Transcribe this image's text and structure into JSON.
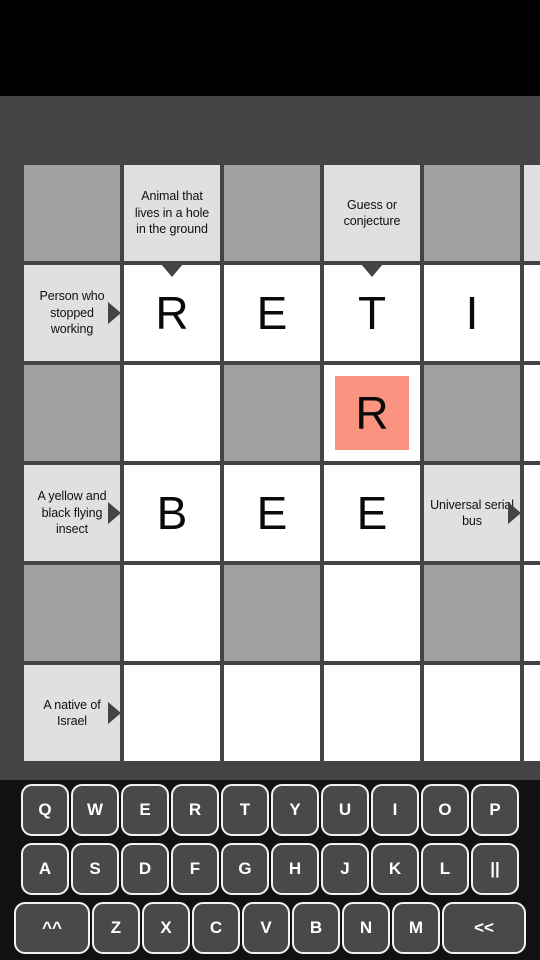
{
  "app": {
    "type": "crossword-puzzle",
    "background_color": "#444444",
    "status_bar_color": "#000000"
  },
  "grid": {
    "columns": 6,
    "rows": 6,
    "cell_size_px": 100,
    "colors": {
      "block": "#A0A0A0",
      "clue": "#E0E0E0",
      "letter": "#FFFFFF",
      "highlight": "#FA9480",
      "border": "#444444",
      "text": "#101010"
    },
    "cells": [
      {
        "r": 0,
        "c": 0,
        "kind": "block",
        "text": ""
      },
      {
        "r": 0,
        "c": 1,
        "kind": "clue",
        "text": "Animal that lives in a hole in the ground"
      },
      {
        "r": 0,
        "c": 2,
        "kind": "block",
        "text": ""
      },
      {
        "r": 0,
        "c": 3,
        "kind": "clue",
        "text": "Guess or conjecture"
      },
      {
        "r": 0,
        "c": 4,
        "kind": "block",
        "text": ""
      },
      {
        "r": 0,
        "c": 5,
        "kind": "clue",
        "text": ""
      },
      {
        "r": 1,
        "c": 0,
        "kind": "clue",
        "text": "Person who stopped working",
        "arrow": "right"
      },
      {
        "r": 1,
        "c": 1,
        "kind": "letter",
        "text": "R",
        "arrow": "down"
      },
      {
        "r": 1,
        "c": 2,
        "kind": "letter",
        "text": "E"
      },
      {
        "r": 1,
        "c": 3,
        "kind": "letter",
        "text": "T",
        "arrow": "down"
      },
      {
        "r": 1,
        "c": 4,
        "kind": "letter",
        "text": "I"
      },
      {
        "r": 1,
        "c": 5,
        "kind": "letter",
        "text": ""
      },
      {
        "r": 2,
        "c": 0,
        "kind": "block",
        "text": ""
      },
      {
        "r": 2,
        "c": 1,
        "kind": "letter",
        "text": ""
      },
      {
        "r": 2,
        "c": 2,
        "kind": "block",
        "text": ""
      },
      {
        "r": 2,
        "c": 3,
        "kind": "letter",
        "text": "R",
        "highlight": true
      },
      {
        "r": 2,
        "c": 4,
        "kind": "block",
        "text": ""
      },
      {
        "r": 2,
        "c": 5,
        "kind": "letter",
        "text": ""
      },
      {
        "r": 3,
        "c": 0,
        "kind": "clue",
        "text": "A yellow and black flying insect",
        "arrow": "right"
      },
      {
        "r": 3,
        "c": 1,
        "kind": "letter",
        "text": "B"
      },
      {
        "r": 3,
        "c": 2,
        "kind": "letter",
        "text": "E"
      },
      {
        "r": 3,
        "c": 3,
        "kind": "letter",
        "text": "E"
      },
      {
        "r": 3,
        "c": 4,
        "kind": "clue",
        "text": "Universal serial bus",
        "arrow": "right"
      },
      {
        "r": 3,
        "c": 5,
        "kind": "letter",
        "text": ""
      },
      {
        "r": 4,
        "c": 0,
        "kind": "block",
        "text": ""
      },
      {
        "r": 4,
        "c": 1,
        "kind": "letter",
        "text": ""
      },
      {
        "r": 4,
        "c": 2,
        "kind": "block",
        "text": ""
      },
      {
        "r": 4,
        "c": 3,
        "kind": "letter",
        "text": ""
      },
      {
        "r": 4,
        "c": 4,
        "kind": "block",
        "text": ""
      },
      {
        "r": 4,
        "c": 5,
        "kind": "letter",
        "text": ""
      },
      {
        "r": 5,
        "c": 0,
        "kind": "clue",
        "text": "A native of Israel",
        "arrow": "right"
      },
      {
        "r": 5,
        "c": 1,
        "kind": "letter",
        "text": ""
      },
      {
        "r": 5,
        "c": 2,
        "kind": "letter",
        "text": ""
      },
      {
        "r": 5,
        "c": 3,
        "kind": "letter",
        "text": ""
      },
      {
        "r": 5,
        "c": 4,
        "kind": "letter",
        "text": ""
      },
      {
        "r": 5,
        "c": 5,
        "kind": "letter",
        "text": ""
      }
    ]
  },
  "keyboard": {
    "background_color": "#111111",
    "key_fill": "#494949",
    "key_border": "#F2F2F2",
    "key_text": "#FFFFFF",
    "rows": [
      [
        {
          "label": "Q",
          "name": "key-q"
        },
        {
          "label": "W",
          "name": "key-w"
        },
        {
          "label": "E",
          "name": "key-e"
        },
        {
          "label": "R",
          "name": "key-r"
        },
        {
          "label": "T",
          "name": "key-t"
        },
        {
          "label": "Y",
          "name": "key-y"
        },
        {
          "label": "U",
          "name": "key-u"
        },
        {
          "label": "I",
          "name": "key-i"
        },
        {
          "label": "O",
          "name": "key-o"
        },
        {
          "label": "P",
          "name": "key-p"
        }
      ],
      [
        {
          "label": "A",
          "name": "key-a"
        },
        {
          "label": "S",
          "name": "key-s"
        },
        {
          "label": "D",
          "name": "key-d"
        },
        {
          "label": "F",
          "name": "key-f"
        },
        {
          "label": "G",
          "name": "key-g"
        },
        {
          "label": "H",
          "name": "key-h"
        },
        {
          "label": "J",
          "name": "key-j"
        },
        {
          "label": "K",
          "name": "key-k"
        },
        {
          "label": "L",
          "name": "key-l"
        },
        {
          "label": "||",
          "name": "key-pause"
        }
      ],
      [
        {
          "label": "^^",
          "name": "key-shift",
          "size": "wide"
        },
        {
          "label": "Z",
          "name": "key-z"
        },
        {
          "label": "X",
          "name": "key-x"
        },
        {
          "label": "C",
          "name": "key-c"
        },
        {
          "label": "V",
          "name": "key-v"
        },
        {
          "label": "B",
          "name": "key-b"
        },
        {
          "label": "N",
          "name": "key-n"
        },
        {
          "label": "M",
          "name": "key-m"
        },
        {
          "label": "<<",
          "name": "key-backspace",
          "size": "xwide"
        }
      ]
    ]
  }
}
